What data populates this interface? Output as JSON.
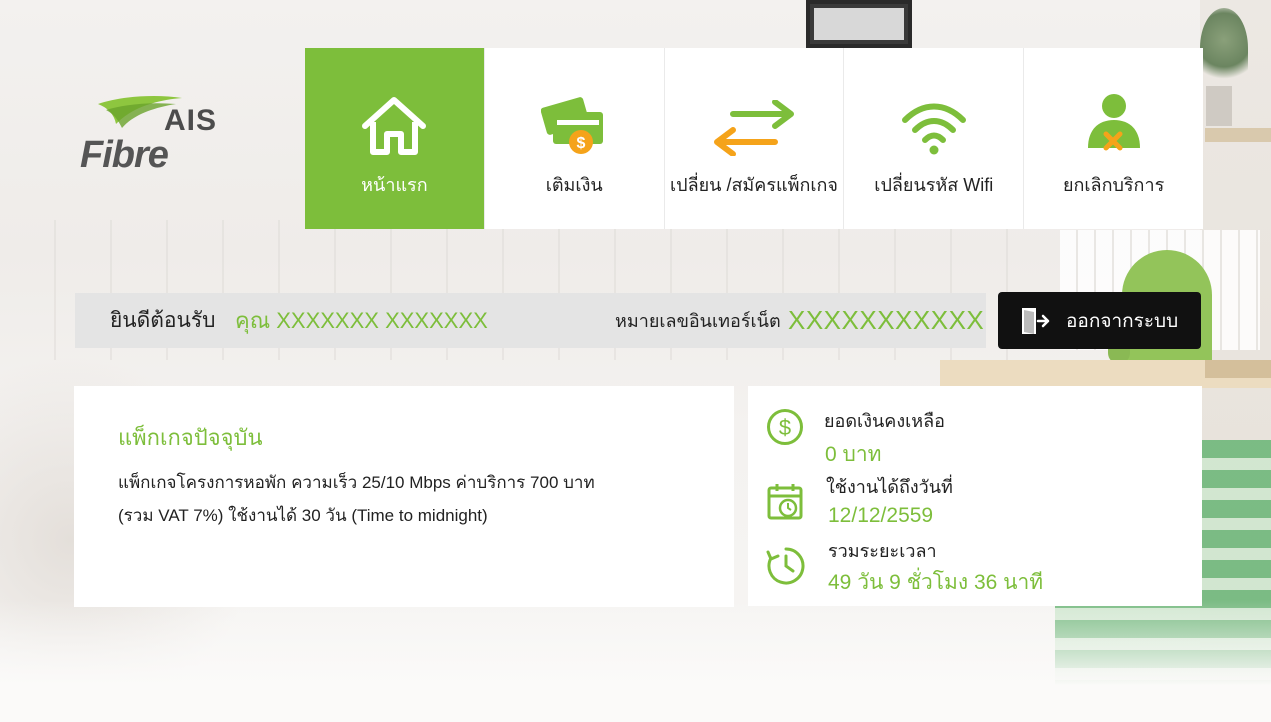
{
  "brand": {
    "line1": "AIS",
    "line2": "Fibre"
  },
  "nav": {
    "items": [
      {
        "label": "หน้าแรก",
        "icon": "home-icon",
        "active": true
      },
      {
        "label": "เติมเงิน",
        "icon": "topup-card-icon",
        "active": false
      },
      {
        "label": "เปลี่ยน /สมัครแพ็กเกจ",
        "icon": "exchange-arrows-icon",
        "active": false
      },
      {
        "label": "เปลี่ยนรหัส Wifi",
        "icon": "wifi-icon",
        "active": false
      },
      {
        "label": "ยกเลิกบริการ",
        "icon": "cancel-user-icon",
        "active": false
      }
    ]
  },
  "welcome": {
    "greeting": "ยินดีต้อนรับ",
    "name": "คุณ XXXXXXX  XXXXXXX",
    "internet_label": "หมายเลขอินเทอร์เน็ต",
    "internet_number": "XXXXXXXXXXX"
  },
  "logout": {
    "label": "ออกจากระบบ"
  },
  "package": {
    "title": "แพ็กเกจปัจจุบัน",
    "line1": "แพ็กเกจโครงการหอพัก ความเร็ว 25/10 Mbps ค่าบริการ 700 บาท",
    "line2": "(รวม VAT 7%) ใช้งานได้ 30 วัน (Time to midnight)"
  },
  "info": {
    "balance_label": "ยอดเงินคงเหลือ",
    "balance_value": "0 บาท",
    "expiry_label": "ใช้งานได้ถึงวันที่",
    "expiry_value": "12/12/2559",
    "duration_label": "รวมระยะเวลา",
    "duration_value": "49 วัน 9 ชั่วโมง 36 นาที"
  },
  "colors": {
    "accent": "#7dbe3b",
    "icon_orange": "#f5a31a",
    "dark": "#111111"
  }
}
